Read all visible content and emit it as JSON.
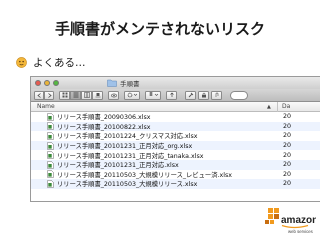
{
  "slide": {
    "title": "手順書がメンテされないリスク",
    "bullet": "よくある…"
  },
  "finder": {
    "window_title": "手順書",
    "columns": {
      "name": "Name",
      "date": "Da"
    },
    "files": [
      {
        "name": "リリース手順書_20090306.xlsx",
        "date": "20"
      },
      {
        "name": "リリース手順書_20100822.xlsx",
        "date": "20"
      },
      {
        "name": "リリース手順書_20101224_クリスマス対応.xlsx",
        "date": "20"
      },
      {
        "name": "リリース手順書_20101231_正月対応_org.xlsx",
        "date": "20"
      },
      {
        "name": "リリース手順書_20101231_正月対応_tanaka.xlsx",
        "date": "20"
      },
      {
        "name": "リリース手順書_20101231_正月対応.xlsx",
        "date": "20"
      },
      {
        "name": "リリース手順書_20110503_大規模リリース_レビュー済.xlsx",
        "date": "20"
      },
      {
        "name": "リリース手順書_20110503_大規模リリース.xlsx",
        "date": "20"
      }
    ]
  },
  "logo": {
    "wordmark": "amazon",
    "tagline": "web services",
    "brand_color": "#f19a1e"
  },
  "colors": {
    "bullet_icon": "#f3b73a",
    "excel_icon": "#3b8a3a",
    "folder_icon": "#9fc1e8"
  }
}
